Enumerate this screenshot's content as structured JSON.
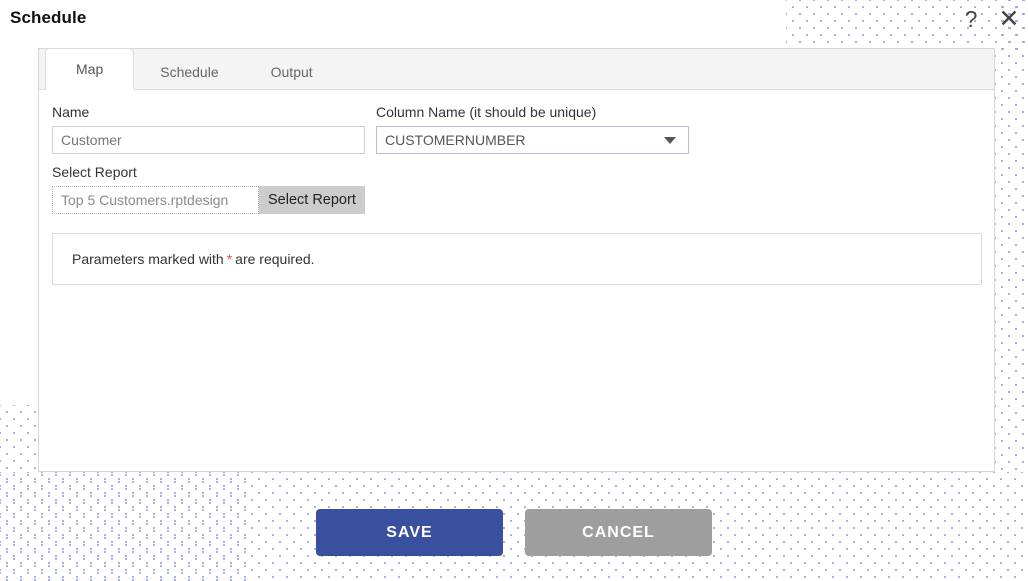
{
  "header": {
    "title": "Schedule",
    "help_icon": "question-mark-icon",
    "close_icon": "close-x-icon",
    "help_glyph": "?",
    "close_glyph": "✕"
  },
  "tabs": [
    {
      "label": "Map",
      "active": true
    },
    {
      "label": "Schedule",
      "active": false
    },
    {
      "label": "Output",
      "active": false
    }
  ],
  "form": {
    "name_field": {
      "label": "Name",
      "value": "Customer",
      "placeholder": "Customer"
    },
    "column_name_field": {
      "label": "Column Name (it should be unique)",
      "value": "CUSTOMERNUMBER",
      "options": [
        "CUSTOMERNUMBER"
      ],
      "caret_icon": "chevron-down-icon"
    },
    "select_report": {
      "label": "Select Report",
      "value": "Top 5 Customers.rptdesign",
      "placeholder": "Top 5 Customers.rptdesign",
      "button_label": "Select Report"
    },
    "notice": {
      "prefix": "Parameters marked with",
      "asterisk": "*",
      "suffix": "are required."
    }
  },
  "footer": {
    "save_label": "SAVE",
    "cancel_label": "CANCEL"
  },
  "colors": {
    "save_background": "#39509e",
    "cancel_background": "#9e9e9e",
    "required_asterisk": "#e8504a",
    "dot_pattern": "#9aa4dd",
    "tab_bar_background": "#f4f4f4"
  }
}
